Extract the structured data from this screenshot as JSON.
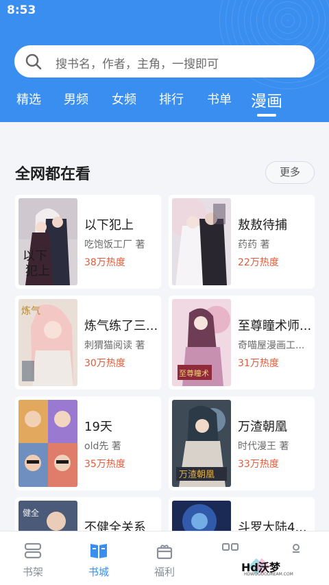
{
  "status_bar": {
    "time": "8:53"
  },
  "search": {
    "placeholder": "搜书名，作者，主角，一搜即可"
  },
  "tabs": [
    {
      "label": "精选"
    },
    {
      "label": "男频"
    },
    {
      "label": "女频"
    },
    {
      "label": "排行"
    },
    {
      "label": "书单"
    },
    {
      "label": "漫画",
      "active": true
    }
  ],
  "section": {
    "title": "全网都在看",
    "more_label": "更多"
  },
  "books": [
    {
      "title": "以下犯上",
      "author": "吃饱饭工厂 著",
      "heat": "38万热度"
    },
    {
      "title": "敖敖待捕",
      "author": "药药 著",
      "heat": "22万热度"
    },
    {
      "title": "炼气练了三...",
      "author": "刺猬猫阅读 著",
      "heat": "30万热度"
    },
    {
      "title": "至尊瞳术师...",
      "author": "奇喵屋漫画工...",
      "heat": "31万热度"
    },
    {
      "title": "19天",
      "author": "old先 著",
      "heat": "35万热度"
    },
    {
      "title": "万渣朝凰",
      "author": "时代漫王 著",
      "heat": "33万热度"
    },
    {
      "title": "不健全关系",
      "author": "",
      "heat": ""
    },
    {
      "title": "斗罗大陆4...",
      "author": "",
      "heat": ""
    }
  ],
  "bottom_nav": [
    {
      "label": "书架",
      "icon": "bookshelf-icon"
    },
    {
      "label": "书城",
      "icon": "bookstore-icon",
      "active": true
    },
    {
      "label": "福利",
      "icon": "gift-icon"
    },
    {
      "label": "",
      "icon": "grid-icon"
    },
    {
      "label": "",
      "icon": "profile-icon"
    }
  ],
  "watermark": {
    "text": "Hd沃梦",
    "sub": "HDWOGOODREAM.COM"
  },
  "colors": {
    "primary": "#3a8ef0",
    "heat": "#e35b3a",
    "background": "#f3f5f9"
  }
}
